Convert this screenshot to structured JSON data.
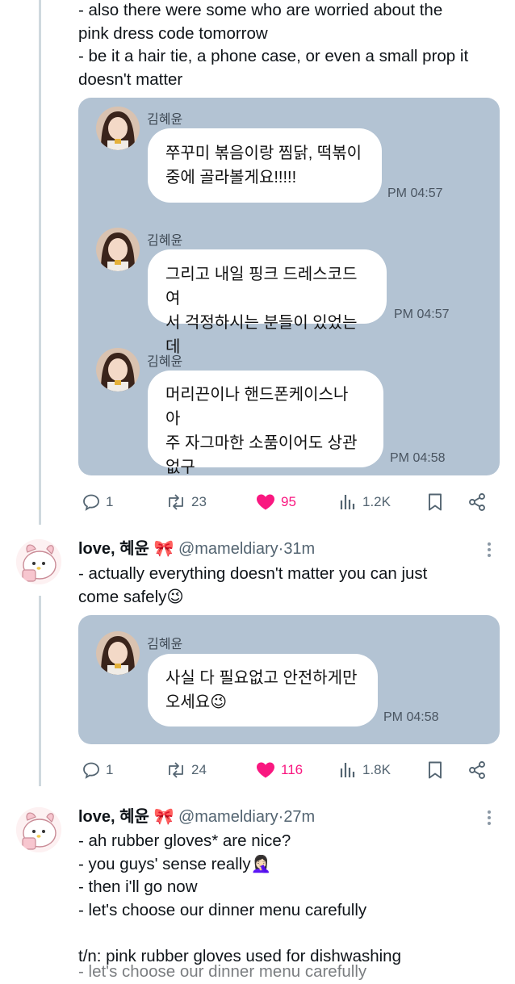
{
  "tweet1": {
    "text": "- also there were some who are worried about the\npink dress code tomorrow\n- be it a hair tie, a phone case, or even a small prop it\ndoesn't matter",
    "chat": [
      {
        "sender": "김혜윤",
        "text": "쭈꾸미 볶음이랑 찜닭, 떡볶이\n중에 골라볼게요!!!!!",
        "time": "PM 04:57"
      },
      {
        "sender": "김혜윤",
        "text": "그리고 내일 핑크 드레스코드여\n서 걱정하시는 분들이 있었는데",
        "time": "PM 04:57"
      },
      {
        "sender": "김혜윤",
        "text": "머리끈이나 핸드폰케이스나 아\n주 자그마한 소품이어도 상관\n없구",
        "time": "PM 04:58"
      }
    ],
    "actions": {
      "replies": "1",
      "reposts": "23",
      "likes": "95",
      "views": "1.2K"
    }
  },
  "tweet2": {
    "name": "love, 혜윤 🎀",
    "handle": "@mameldiary",
    "separator": "·",
    "ago": "31m",
    "text": "- actually everything doesn't matter you can just\ncome safely😉",
    "chat": [
      {
        "sender": "김혜윤",
        "text": "사실 다 필요없고 안전하게만\n오세요😉",
        "time": "PM 04:58"
      }
    ],
    "actions": {
      "replies": "1",
      "reposts": "24",
      "likes": "116",
      "views": "1.8K"
    }
  },
  "tweet3": {
    "name": "love, 혜윤 🎀",
    "handle": "@mameldiary",
    "separator": "·",
    "ago": "27m",
    "text": "- ah rubber gloves* are nice?\n- you guys' sense really🤦🏻‍♀️\n- then i'll go now\n- let's choose our dinner menu carefully\n\nt/n: pink rubber gloves used for dishwashing",
    "overflow_text": "- let's choose our dinner menu carefully"
  },
  "colors": {
    "chat_bg": "#b3c3d3",
    "like": "#f91880",
    "muted": "#536471",
    "thread": "#cfd9de"
  },
  "icons": [
    "reply-icon",
    "repost-icon",
    "heart-icon",
    "views-icon",
    "bookmark-icon",
    "share-icon",
    "more-icon"
  ]
}
